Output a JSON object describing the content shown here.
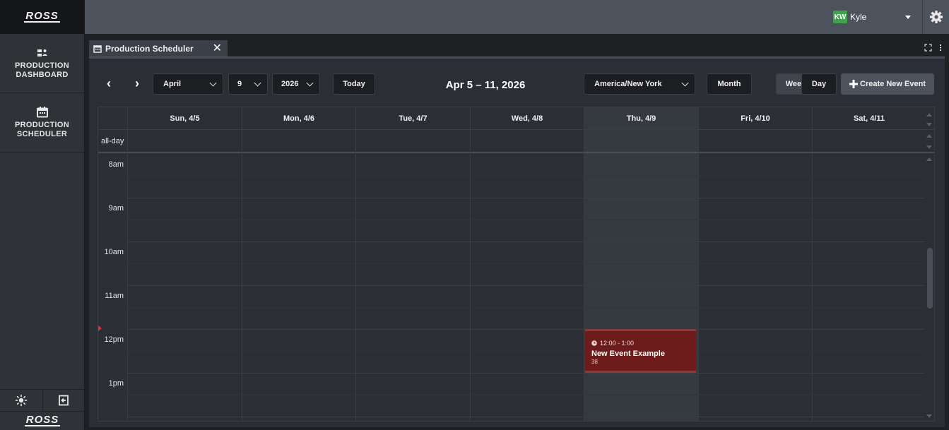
{
  "brand": {
    "logo": "ROSS"
  },
  "sidebar": {
    "items": [
      {
        "label": "PRODUCTION DASHBOARD",
        "icon": "dashboard-icon"
      },
      {
        "label": "PRODUCTION SCHEDULER",
        "icon": "calendar-icon"
      }
    ],
    "tools": [
      "brightness-icon",
      "logout-icon"
    ]
  },
  "topbar": {
    "user": {
      "initials": "KW",
      "name": "Kyle"
    },
    "settings_icon": "gear-icon"
  },
  "tab": {
    "title": "Production Scheduler",
    "close": "✕"
  },
  "toolbar": {
    "prev": "‹",
    "next": "›",
    "month": "April",
    "day": "9",
    "year": "2026",
    "today_label": "Today",
    "range_title": "Apr 5 – 11, 2026",
    "timezone": "America/New York",
    "views": [
      "Month",
      "Week",
      "Day"
    ],
    "active_view": "Week",
    "create_label": "Create New Event"
  },
  "calendar": {
    "days": [
      "Sun, 4/5",
      "Mon, 4/6",
      "Tue, 4/7",
      "Wed, 4/8",
      "Thu, 4/9",
      "Fri, 4/10",
      "Sat, 4/11"
    ],
    "today_index": 4,
    "allday_label": "all-day",
    "hours": [
      "8am",
      "9am",
      "10am",
      "11am",
      "12pm",
      "1pm"
    ],
    "event": {
      "time": "12:00 - 1:00",
      "title": "New Event Example",
      "subtitle": "38",
      "color": "#6e1b1b"
    }
  }
}
